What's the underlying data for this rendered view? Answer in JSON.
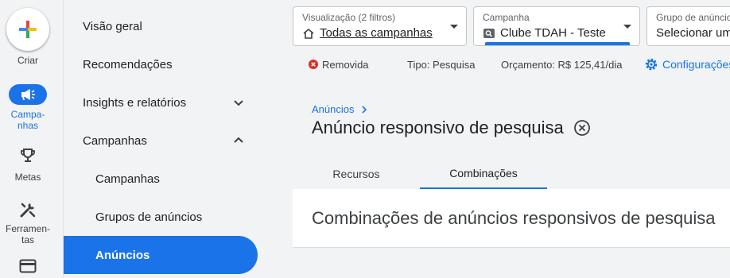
{
  "rail": {
    "create_label": "Criar",
    "campaigns_label_line1": "Campa-",
    "campaigns_label_line2": "nhas",
    "goals_label": "Metas",
    "tools_label_line1": "Ferramen-",
    "tools_label_line2": "tas"
  },
  "nav": {
    "items": [
      {
        "label": "Visão geral"
      },
      {
        "label": "Recomendações"
      },
      {
        "label": "Insights e relatórios"
      },
      {
        "label": "Campanhas"
      },
      {
        "label": "Campanhas"
      },
      {
        "label": "Grupos de anúncios"
      },
      {
        "label": "Anúncios"
      }
    ]
  },
  "selectors": {
    "view": {
      "caption": "Visualização (2 filtros)",
      "value": "Todas as campanhas"
    },
    "campaign": {
      "caption": "Campanha",
      "value": "Clube TDAH - Teste"
    },
    "adgroup": {
      "caption": "Grupo de anúncios",
      "value": "Selecionar um"
    }
  },
  "status": {
    "removed": "Removida",
    "type": "Tipo: Pesquisa",
    "budget": "Orçamento: R$ 125,41/dia",
    "settings": "Configurações"
  },
  "main": {
    "breadcrumb": "Anúncios",
    "title": "Anúncio responsivo de pesquisa",
    "tabs": [
      {
        "label": "Recursos"
      },
      {
        "label": "Combinações"
      }
    ],
    "panel_title": "Combinações de anúncios responsivos de pesquisa"
  },
  "colors": {
    "accent": "#1a73e8",
    "removed_red": "#d93025"
  }
}
